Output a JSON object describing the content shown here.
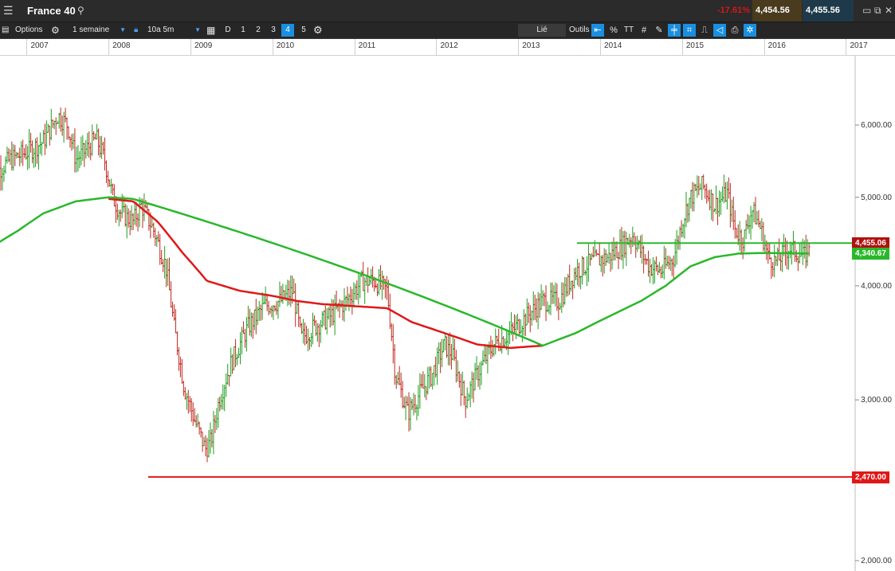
{
  "header": {
    "menu_icon": "menu-icon",
    "title": "France 40",
    "change_pct": "-17.61%",
    "sell_price": "4,454.56",
    "buy_price": "4,455.56",
    "colors": {
      "sell_bg": "#4a3a1e",
      "buy_bg": "#1e3a4a",
      "negative": "#d21818"
    }
  },
  "toolbar": {
    "options_label": "Options",
    "interval": "1 semaine",
    "range": "10a 5m",
    "periods": [
      "D",
      "1",
      "2",
      "3",
      "4",
      "5"
    ],
    "active_period": "4",
    "linked_label": "Lié",
    "tools_label": "Outils",
    "percent_label": "%"
  },
  "chart_data": {
    "type": "ohlc",
    "x_ticks": [
      "2007",
      "2008",
      "2009",
      "2010",
      "2011",
      "2012",
      "2013",
      "2014",
      "2015",
      "2016",
      "2017"
    ],
    "y_ticks": [
      "2,000.00",
      "3,000.00",
      "4,000.00",
      "5,000.00",
      "6,000.00"
    ],
    "y_scale": "log",
    "ylim": [
      1990,
      6790
    ],
    "colors": {
      "up": "#1e9e1e",
      "down": "#c0281e",
      "ma_red": "#e01818",
      "ma_green": "#2ab82a"
    },
    "price_path": [
      [
        2006.55,
        5250
      ],
      [
        2006.8,
        5500
      ],
      [
        2007.0,
        5600
      ],
      [
        2007.2,
        5750
      ],
      [
        2007.38,
        6150
      ],
      [
        2007.5,
        6000
      ],
      [
        2007.6,
        5500
      ],
      [
        2007.7,
        5600
      ],
      [
        2007.85,
        5800
      ],
      [
        2007.95,
        5500
      ],
      [
        2008.05,
        5000
      ],
      [
        2008.15,
        4800
      ],
      [
        2008.3,
        4700
      ],
      [
        2008.4,
        4900
      ],
      [
        2008.55,
        4600
      ],
      [
        2008.7,
        4200
      ],
      [
        2008.8,
        3600
      ],
      [
        2008.92,
        3100
      ],
      [
        2009.05,
        2850
      ],
      [
        2009.18,
        2650
      ],
      [
        2009.25,
        2700
      ],
      [
        2009.35,
        3000
      ],
      [
        2009.5,
        3300
      ],
      [
        2009.7,
        3600
      ],
      [
        2009.9,
        3800
      ],
      [
        2010.1,
        3850
      ],
      [
        2010.25,
        3950
      ],
      [
        2010.35,
        3500
      ],
      [
        2010.5,
        3600
      ],
      [
        2010.7,
        3700
      ],
      [
        2010.9,
        3850
      ],
      [
        2011.1,
        4050
      ],
      [
        2011.25,
        4050
      ],
      [
        2011.4,
        3950
      ],
      [
        2011.5,
        3200
      ],
      [
        2011.65,
        2900
      ],
      [
        2011.8,
        3050
      ],
      [
        2011.95,
        3200
      ],
      [
        2012.1,
        3450
      ],
      [
        2012.2,
        3350
      ],
      [
        2012.35,
        3000
      ],
      [
        2012.5,
        3200
      ],
      [
        2012.7,
        3450
      ],
      [
        2012.9,
        3550
      ],
      [
        2013.1,
        3700
      ],
      [
        2013.3,
        3850
      ],
      [
        2013.5,
        3850
      ],
      [
        2013.7,
        4150
      ],
      [
        2013.9,
        4250
      ],
      [
        2014.1,
        4300
      ],
      [
        2014.3,
        4450
      ],
      [
        2014.4,
        4550
      ],
      [
        2014.5,
        4350
      ],
      [
        2014.6,
        4200
      ],
      [
        2014.75,
        4150
      ],
      [
        2014.9,
        4300
      ],
      [
        2015.0,
        4700
      ],
      [
        2015.1,
        5000
      ],
      [
        2015.25,
        5150
      ],
      [
        2015.4,
        4900
      ],
      [
        2015.55,
        5050
      ],
      [
        2015.65,
        4600
      ],
      [
        2015.75,
        4500
      ],
      [
        2015.85,
        4850
      ],
      [
        2015.95,
        4650
      ],
      [
        2016.05,
        4300
      ],
      [
        2016.15,
        4250
      ],
      [
        2016.3,
        4400
      ],
      [
        2016.4,
        4350
      ],
      [
        2016.5,
        4300
      ],
      [
        2016.55,
        4455
      ]
    ],
    "ma_red": [
      [
        2008.0,
        4980
      ],
      [
        2008.3,
        4950
      ],
      [
        2008.6,
        4700
      ],
      [
        2008.9,
        4350
      ],
      [
        2009.2,
        4050
      ],
      [
        2009.6,
        3950
      ],
      [
        2010.0,
        3900
      ],
      [
        2010.3,
        3850
      ],
      [
        2010.6,
        3820
      ],
      [
        2011.0,
        3800
      ],
      [
        2011.4,
        3780
      ],
      [
        2011.7,
        3650
      ],
      [
        2012.1,
        3550
      ],
      [
        2012.5,
        3450
      ],
      [
        2012.9,
        3420
      ],
      [
        2013.3,
        3440
      ]
    ],
    "ma_green": [
      [
        2006.55,
        4400
      ],
      [
        2006.9,
        4600
      ],
      [
        2007.2,
        4800
      ],
      [
        2007.6,
        4950
      ],
      [
        2008.0,
        5000
      ],
      [
        2008.3,
        4980
      ],
      [
        2013.3,
        3440
      ],
      [
        2013.7,
        3550
      ],
      [
        2014.1,
        3700
      ],
      [
        2014.5,
        3850
      ],
      [
        2014.8,
        4000
      ],
      [
        2015.1,
        4200
      ],
      [
        2015.4,
        4300
      ],
      [
        2015.7,
        4340
      ],
      [
        2016.0,
        4345
      ],
      [
        2016.55,
        4340
      ]
    ],
    "support_line": 2470,
    "resistance_line": 4455.06,
    "price_labels": {
      "current": "4,455.06",
      "ma": "4,340.67",
      "support": "2,470.00"
    }
  }
}
